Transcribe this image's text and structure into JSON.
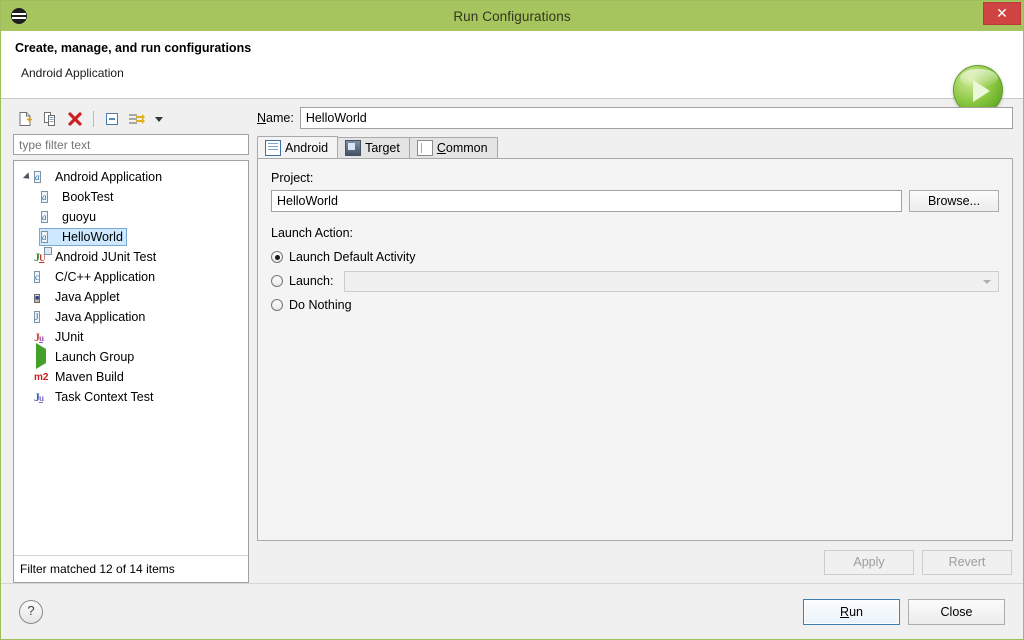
{
  "window": {
    "title": "Run Configurations",
    "app_icon": "eclipse-icon",
    "close_label": "✕"
  },
  "header": {
    "title": "Create, manage, and run configurations",
    "subtitle": "Android Application",
    "run_icon": "run-play-icon"
  },
  "left_pane": {
    "toolbar": [
      {
        "name": "new-configuration-icon",
        "title": "New launch configuration"
      },
      {
        "name": "duplicate-configuration-icon",
        "title": "Duplicate currently selected launch configuration"
      },
      {
        "name": "delete-configuration-icon",
        "title": "Delete selected launch configuration(s)"
      },
      {
        "name": "collapse-all-icon",
        "title": "Collapse All"
      },
      {
        "name": "filter-icon",
        "title": "Filter launch configurations"
      },
      {
        "name": "view-menu-caret-icon",
        "title": "View Menu"
      }
    ],
    "filter": {
      "placeholder": "type filter text",
      "value": ""
    },
    "tree": [
      {
        "label": "Android Application",
        "icon": "android-config-icon",
        "depth": 0,
        "expandable": true,
        "expanded": true,
        "selected": false
      },
      {
        "label": "BookTest",
        "icon": "android-config-icon",
        "depth": 1,
        "expandable": false,
        "expanded": false,
        "selected": false
      },
      {
        "label": "guoyu",
        "icon": "android-config-icon",
        "depth": 1,
        "expandable": false,
        "expanded": false,
        "selected": false
      },
      {
        "label": "HelloWorld",
        "icon": "android-config-icon",
        "depth": 1,
        "expandable": false,
        "expanded": false,
        "selected": true
      },
      {
        "label": "Android JUnit Test",
        "icon": "android-junit-icon",
        "depth": 0,
        "expandable": false,
        "expanded": false,
        "selected": false
      },
      {
        "label": "C/C++ Application",
        "icon": "c-application-icon",
        "depth": 0,
        "expandable": false,
        "expanded": false,
        "selected": false
      },
      {
        "label": "Java Applet",
        "icon": "java-applet-icon",
        "depth": 0,
        "expandable": false,
        "expanded": false,
        "selected": false
      },
      {
        "label": "Java Application",
        "icon": "java-application-icon",
        "depth": 0,
        "expandable": false,
        "expanded": false,
        "selected": false
      },
      {
        "label": "JUnit",
        "icon": "junit-icon",
        "depth": 0,
        "expandable": false,
        "expanded": false,
        "selected": false
      },
      {
        "label": "Launch Group",
        "icon": "launch-group-icon",
        "depth": 0,
        "expandable": false,
        "expanded": false,
        "selected": false
      },
      {
        "label": "Maven Build",
        "icon": "maven-build-icon",
        "depth": 0,
        "expandable": false,
        "expanded": false,
        "selected": false
      },
      {
        "label": "Task Context Test",
        "icon": "task-context-test-icon",
        "depth": 0,
        "expandable": false,
        "expanded": false,
        "selected": false
      }
    ],
    "status": "Filter matched 12 of 14 items"
  },
  "right_pane": {
    "name_label": "Name:",
    "name_label_mnemonic": "N",
    "name_value": "HelloWorld",
    "tabs": [
      {
        "label": "Android",
        "icon": "android-tab-icon",
        "active": true,
        "mnemonic": ""
      },
      {
        "label": "Target",
        "icon": "target-device-icon",
        "active": false,
        "mnemonic": ""
      },
      {
        "label": "Common",
        "icon": "common-tab-icon",
        "active": false,
        "mnemonic": "C"
      }
    ],
    "project_group_label": "Project:",
    "project_value": "HelloWorld",
    "browse_label": "Browse...",
    "launch_action_label": "Launch Action:",
    "launch_options": [
      {
        "label": "Launch Default Activity",
        "checked": true,
        "has_combo": false
      },
      {
        "label": "Launch:",
        "checked": false,
        "has_combo": true,
        "combo_value": "",
        "combo_enabled": false
      },
      {
        "label": "Do Nothing",
        "checked": false,
        "has_combo": false
      }
    ],
    "apply_label": "Apply",
    "apply_enabled": false,
    "revert_label": "Revert",
    "revert_enabled": false
  },
  "footer": {
    "help_icon": "help-question-icon",
    "help_label": "?",
    "run_label": "Run",
    "run_mnemonic": "R",
    "close_label": "Close"
  },
  "colors": {
    "titlebar": "#a7c55f",
    "close_button": "#cf4343",
    "selection": "#cde8ff",
    "selection_border": "#7aa8d4",
    "panel": "#f0f0f0",
    "tab_panel": "#f4f4f4",
    "accent_run": "#3c7fb1"
  }
}
